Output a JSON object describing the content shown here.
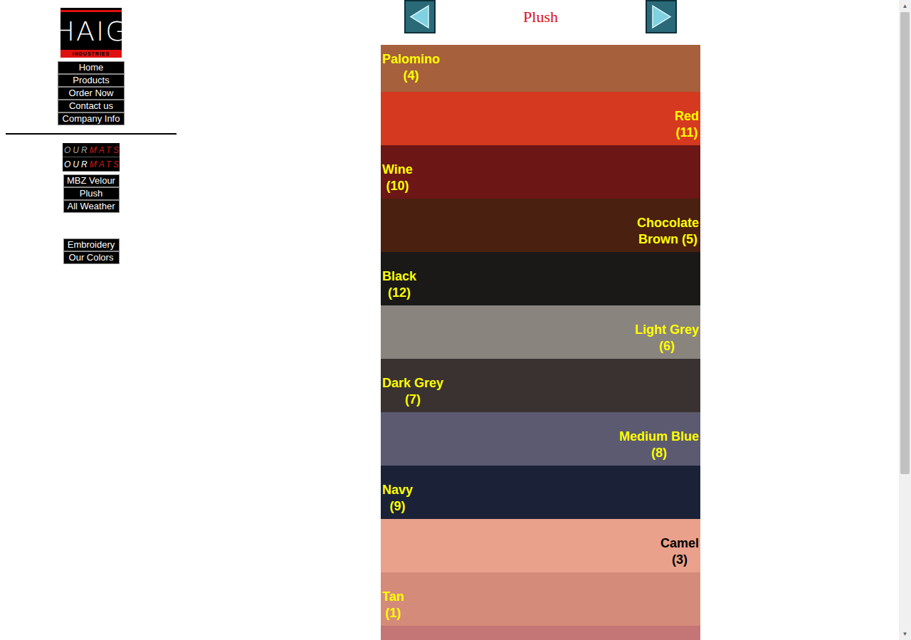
{
  "logo": {
    "name": "HAIG",
    "tagline": "INDUSTRIES"
  },
  "nav": [
    {
      "label": "Home"
    },
    {
      "label": "Products"
    },
    {
      "label": "Order Now"
    },
    {
      "label": "Contact us"
    },
    {
      "label": "Company Info"
    }
  ],
  "our_mats": {
    "lines": [
      {
        "a": "OUR",
        "b": "MATS"
      },
      {
        "a": "OUR",
        "b": "MATS"
      }
    ]
  },
  "mats": [
    {
      "label": "MBZ Velour"
    },
    {
      "label": "Plush"
    },
    {
      "label": "All Weather"
    }
  ],
  "extras": [
    {
      "label": "Embroidery"
    },
    {
      "label": "Our Colors"
    }
  ],
  "page": {
    "title": "Plush"
  },
  "swatches": [
    {
      "lines": [
        "Palomino",
        "(4)"
      ],
      "side": "left",
      "color": "#a6603c",
      "label_color": "#ffff00"
    },
    {
      "lines": [
        "Red",
        "(11)"
      ],
      "side": "right",
      "color": "#d53a20",
      "label_color": "#ffff00"
    },
    {
      "lines": [
        "Wine",
        "(10)"
      ],
      "side": "left",
      "color": "#6c1616",
      "label_color": "#ffff00"
    },
    {
      "lines": [
        "Chocolate",
        "Brown (5)"
      ],
      "side": "right",
      "color": "#4a2010",
      "label_color": "#ffff00"
    },
    {
      "lines": [
        "Black",
        "(12)"
      ],
      "side": "left",
      "color": "#1a1918",
      "label_color": "#ffff00"
    },
    {
      "lines": [
        "Light Grey",
        "(6)"
      ],
      "side": "right",
      "color": "#8a847e",
      "label_color": "#ffff00"
    },
    {
      "lines": [
        "Dark Grey",
        "(7)"
      ],
      "side": "left",
      "color": "#3a3230",
      "label_color": "#ffff00"
    },
    {
      "lines": [
        "Medium Blue",
        "(8)"
      ],
      "side": "right",
      "color": "#5b5a70",
      "label_color": "#ffff00"
    },
    {
      "lines": [
        "Navy",
        "(9)"
      ],
      "side": "left",
      "color": "#1b2238",
      "label_color": "#ffff00"
    },
    {
      "lines": [
        "Camel",
        "(3)"
      ],
      "side": "right",
      "color": "#e9a18b",
      "label_color": "#000000"
    },
    {
      "lines": [
        "Tan",
        "(1)"
      ],
      "side": "left",
      "color": "#d58b79",
      "label_color": "#ffff00"
    },
    {
      "lines": [],
      "side": "right",
      "color": "#c47676",
      "label_color": "#ffff00"
    }
  ],
  "scrollbar": {
    "up": "▲",
    "down": "▼",
    "level": 0.75
  }
}
